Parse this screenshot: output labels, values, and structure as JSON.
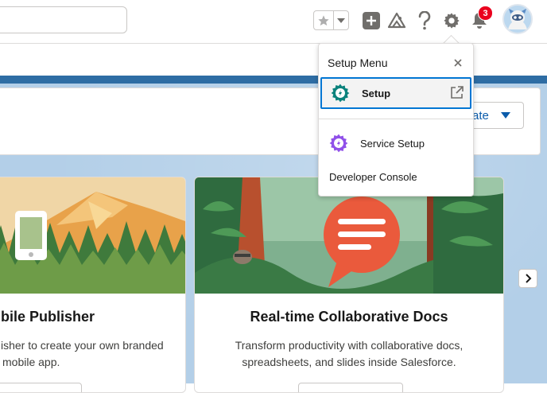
{
  "header": {
    "search": {
      "placeholder": ""
    },
    "notifications": {
      "count": "3"
    },
    "icons": [
      "star-icon",
      "chevron-down-icon",
      "plus-icon",
      "trailhead-icon",
      "help-icon",
      "gear-icon",
      "bell-icon",
      "avatar"
    ]
  },
  "panel": {
    "create_button_label": "ate"
  },
  "cards": [
    {
      "title": "bile Publisher",
      "description_line1": "isher to create your own branded",
      "description_line2": "mobile app."
    },
    {
      "title": "Real-time Collaborative Docs",
      "description_line1": "Transform productivity with collaborative docs,",
      "description_line2": "spreadsheets, and slides inside Salesforce."
    }
  ],
  "setup_menu": {
    "title": "Setup Menu",
    "items": [
      {
        "label": "Setup",
        "icon": "gear-icon",
        "external": true
      },
      {
        "label": "Service Setup",
        "icon": "gear-icon"
      },
      {
        "label": "Developer Console"
      }
    ]
  },
  "colors": {
    "brand_blue": "#0176d3",
    "badge_red": "#ea001e",
    "setup_icon": "#0b827c",
    "service_icon": "#9050e9",
    "background_blue": "#b3cfe8"
  }
}
